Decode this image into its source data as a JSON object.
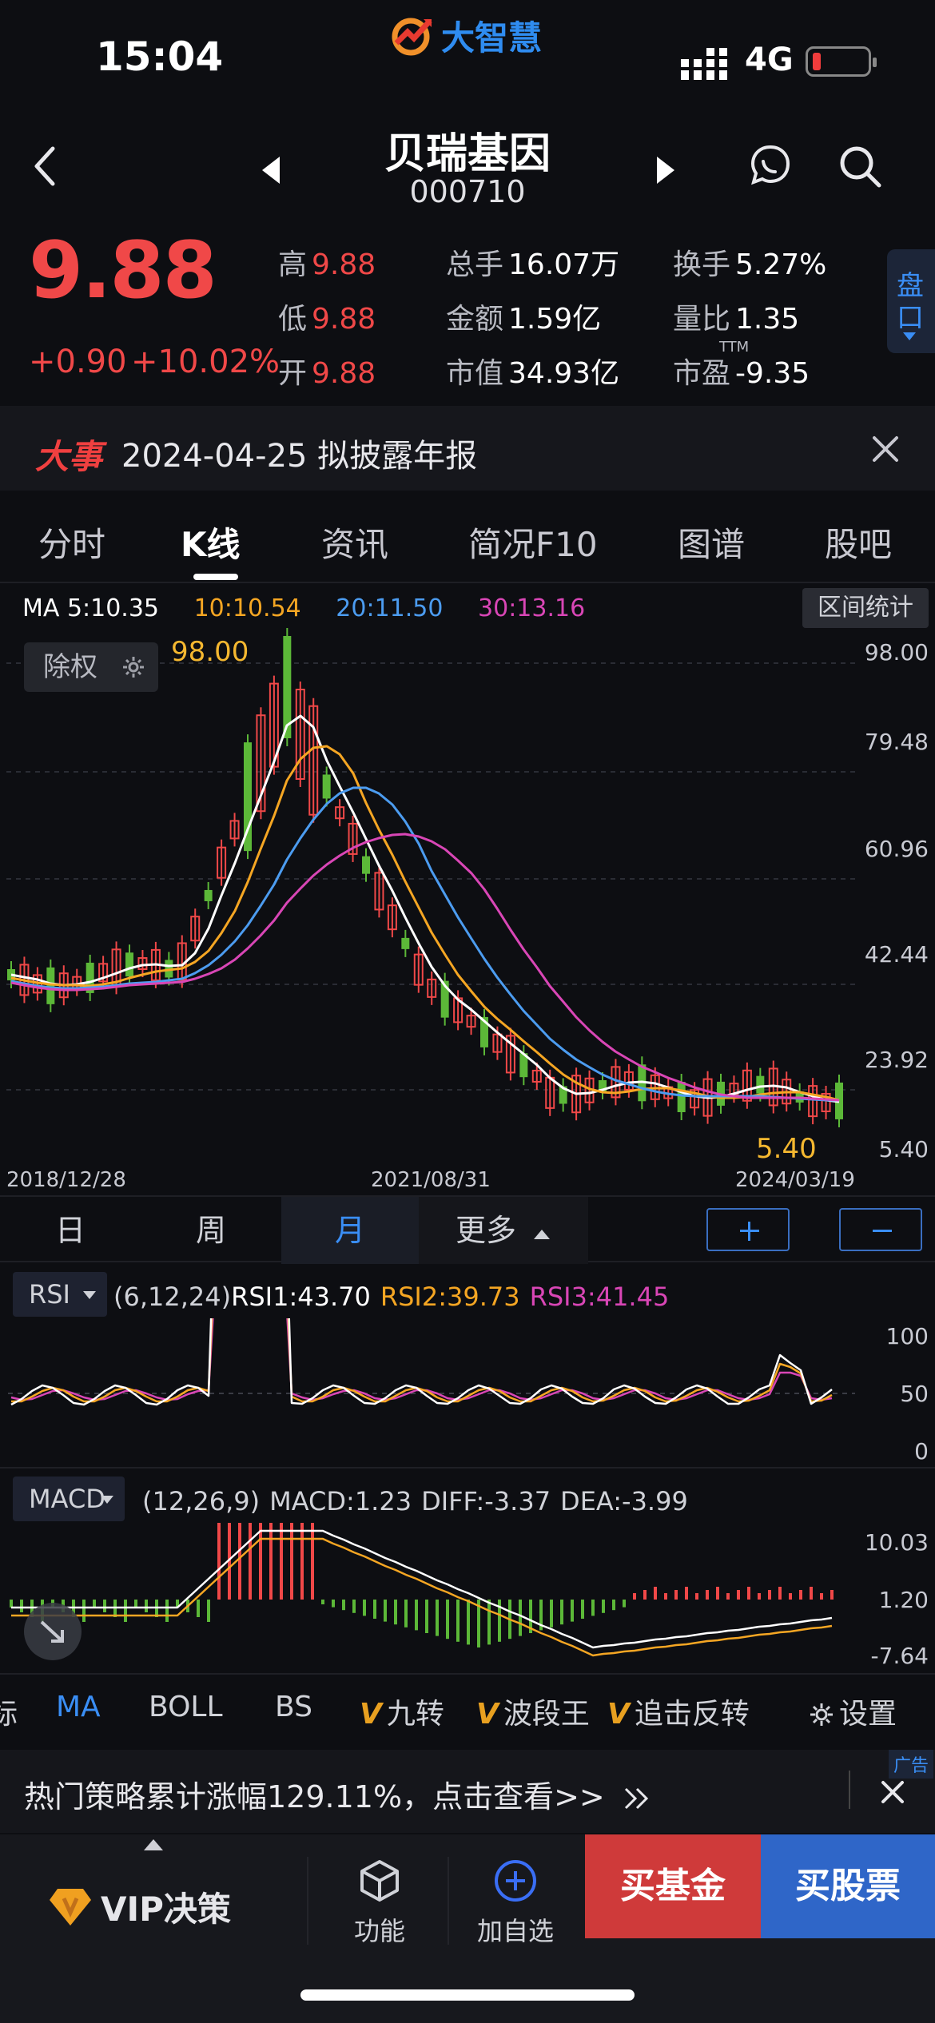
{
  "status": {
    "time": "15:04",
    "app_logo": "大智慧",
    "network": "4G"
  },
  "stock": {
    "name": "贝瑞基因",
    "code": "000710"
  },
  "quote": {
    "price": "9.88",
    "change_abs": "+0.90",
    "change_pct": "+10.02%",
    "high_label": "高",
    "high": "9.88",
    "low_label": "低",
    "low": "9.88",
    "open_label": "开",
    "open": "9.88",
    "volume_label": "总手",
    "volume": "16.07万",
    "amount_label": "金额",
    "amount": "1.59亿",
    "mktcap_label": "市值",
    "mktcap": "34.93亿",
    "turnover_label": "换手",
    "turnover": "5.27%",
    "volratio_label": "量比",
    "volratio": "1.35",
    "pe_label": "市盈",
    "pe_sup": "TTM",
    "pe": "-9.35",
    "pankou": [
      "盘",
      "口"
    ]
  },
  "event": {
    "tag": "大事",
    "text": "2024-04-25 拟披露年报"
  },
  "tabs": [
    "分时",
    "K线",
    "资讯",
    "简况F10",
    "图谱",
    "股吧"
  ],
  "ma_legend": {
    "ma5": "MA 5:10.35",
    "ma10": "10:10.54",
    "ma20": "20:11.50",
    "ma30": "30:13.16"
  },
  "range_button": "区间统计",
  "fuquan_button": "除权",
  "kline_axis": {
    "y_ticks": [
      "98.00",
      "79.48",
      "60.96",
      "42.44",
      "23.92",
      "5.40"
    ],
    "dates": [
      "2018/12/28",
      "2021/08/31",
      "2024/03/19"
    ],
    "max_mark": "98.00",
    "min_mark": "5.40"
  },
  "periods": [
    "日",
    "周",
    "月",
    "更多"
  ],
  "rsi": {
    "selector": "RSI",
    "params": "(6,12,24)",
    "rsi1": "RSI1:43.70",
    "rsi2": "RSI2:39.73",
    "rsi3": "RSI3:41.45",
    "y_ticks": [
      "100",
      "50",
      "0"
    ]
  },
  "macd": {
    "selector": "MACD",
    "params": "(12,26,9)",
    "macd": "MACD:1.23",
    "diff": "DIFF:-3.37",
    "dea": "DEA:-3.99",
    "y_ticks": [
      "10.03",
      "1.20",
      "-7.64"
    ]
  },
  "tool_bar": {
    "items": [
      "标",
      "MA",
      "BOLL",
      "BS",
      "九转",
      "波段王",
      "追击反转"
    ],
    "v_mark": "V",
    "settings": "设置"
  },
  "promo": {
    "text": "热门策略累计涨幅129.11%，点击查看>>",
    "ad_tag": "广告"
  },
  "bottom_nav": {
    "vip": "VIP决策",
    "function": "功能",
    "add_watch": "加自选",
    "buy_fund": "买基金",
    "buy_stock": "买股票"
  },
  "colors": {
    "up": "#f04848",
    "down": "#5cb838",
    "ma5": "#ffffff",
    "ma10": "#f5a623",
    "ma20": "#4c9cf0",
    "ma30": "#d946b6",
    "accent": "#3a8ef5"
  }
}
